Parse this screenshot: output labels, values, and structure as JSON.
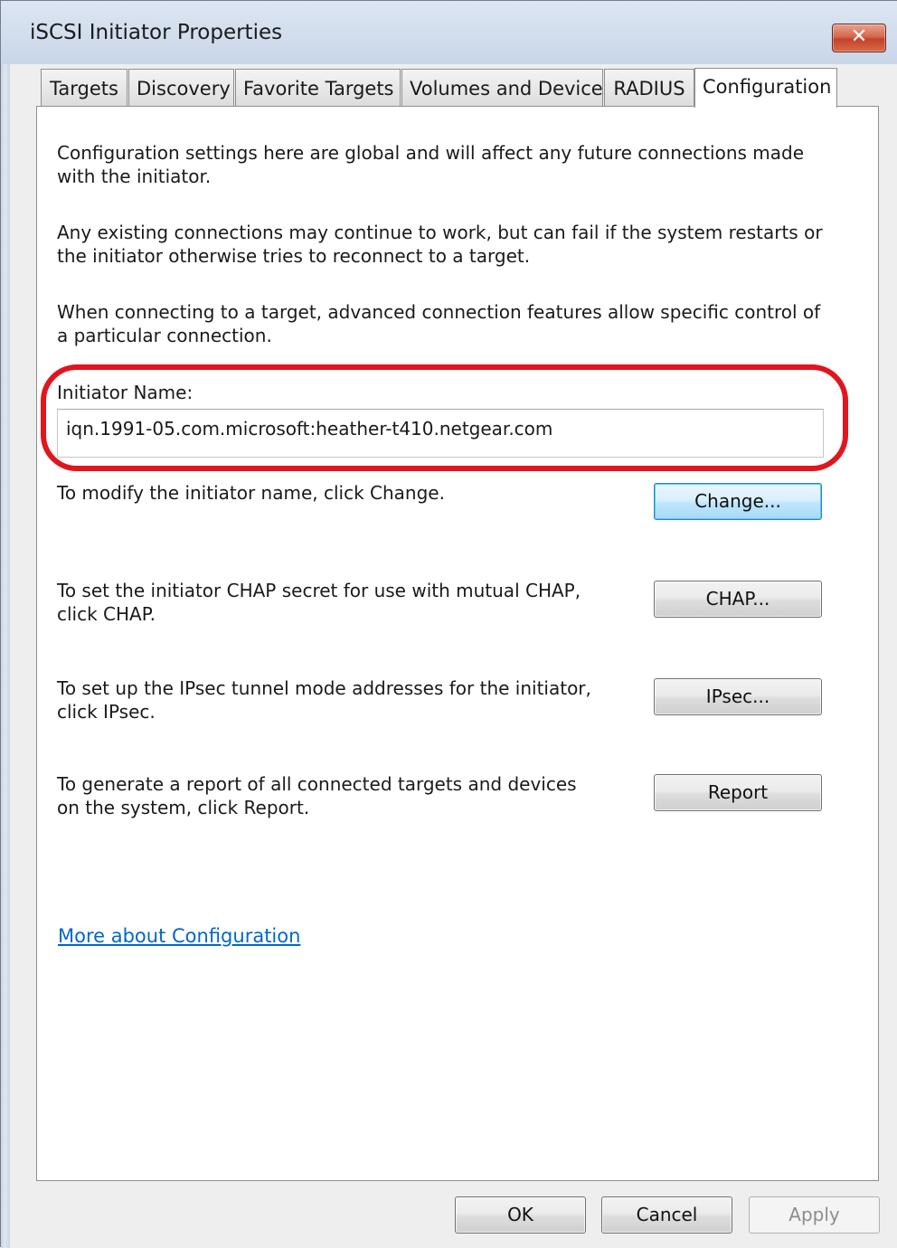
{
  "window": {
    "title": "iSCSI Initiator Properties",
    "close_glyph": "✕"
  },
  "tabs": [
    {
      "label": "Targets",
      "active": false
    },
    {
      "label": "Discovery",
      "active": false
    },
    {
      "label": "Favorite Targets",
      "active": false
    },
    {
      "label": "Volumes and Devices",
      "active": false
    },
    {
      "label": "RADIUS",
      "active": false
    },
    {
      "label": "Configuration",
      "active": true
    }
  ],
  "configuration": {
    "intro_1": "Configuration settings here are global and will affect any future connections made with the initiator.",
    "intro_2": "Any existing connections may continue to work, but can fail if the system restarts or the initiator otherwise tries to reconnect to a target.",
    "intro_3": "When connecting to a target, advanced connection features allow specific control of a particular connection.",
    "initiator_name_label": "Initiator Name:",
    "initiator_name_value": "iqn.1991-05.com.microsoft:heather-t410.netgear.com",
    "change_text": "To modify the initiator name, click Change.",
    "change_button": "Change...",
    "chap_text": "To set the initiator CHAP secret for use with mutual CHAP, click CHAP.",
    "chap_button": "CHAP...",
    "ipsec_text": "To set up the IPsec tunnel mode addresses for the initiator, click IPsec.",
    "ipsec_button": "IPsec...",
    "report_text": "To generate a report of all connected targets and devices on the system, click Report.",
    "report_button": "Report",
    "more_link": "More about Configuration"
  },
  "footer": {
    "ok": "OK",
    "cancel": "Cancel",
    "apply": "Apply"
  },
  "colors": {
    "highlight_ring": "#e0161f",
    "link": "#0066cc",
    "default_button_border": "#3c7fb1"
  }
}
